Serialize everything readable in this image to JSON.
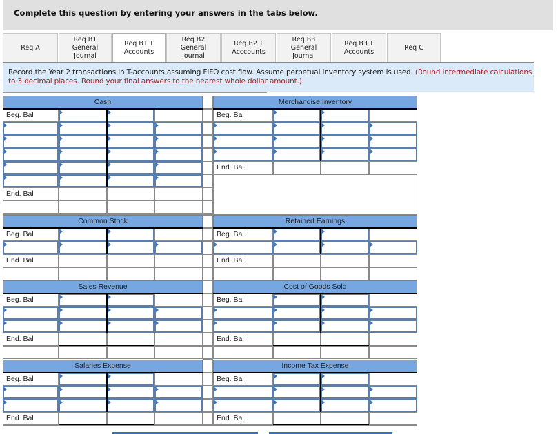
{
  "header": {
    "title": "Complete this question by entering your answers in the tabs below."
  },
  "tabs": [
    {
      "label": "Req A",
      "active": false
    },
    {
      "label": "Req B1\nGeneral\nJournal",
      "active": false
    },
    {
      "label": "Req B1 T\nAccounts",
      "active": true
    },
    {
      "label": "Req B2\nGeneral\nJournal",
      "active": false
    },
    {
      "label": "Req B2 T\nAcccounts",
      "active": false
    },
    {
      "label": "Req B3\nGeneral\nJournal",
      "active": false
    },
    {
      "label": "Req B3 T\nAccounts",
      "active": false
    },
    {
      "label": "Req C",
      "active": false
    }
  ],
  "instructions": {
    "text": "Record the Year 2 transactions in T-accounts assuming FIFO cost flow. Assume perpetual inventory system is used. ",
    "note": "(Round intermediate calculations to 3 decimal places. Round your final answers to the nearest whole dollar amount.)"
  },
  "labels": {
    "beg": "Beg. Bal",
    "end": "End. Bal"
  },
  "accounts": [
    {
      "name": "Cash",
      "side": "left",
      "entry_rows": 5,
      "extra_rows": 1
    },
    {
      "name": "Merchandise Inventory",
      "side": "right",
      "entry_rows": 3,
      "extra_rows": 3
    },
    {
      "name": "Common Stock",
      "side": "left",
      "entry_rows": 1,
      "extra_rows": 1
    },
    {
      "name": "Retained Earnings",
      "side": "right",
      "entry_rows": 1,
      "extra_rows": 1
    },
    {
      "name": "Sales Revenue",
      "side": "left",
      "entry_rows": 2,
      "extra_rows": 1
    },
    {
      "name": "Cost of Goods Sold",
      "side": "right",
      "entry_rows": 2,
      "extra_rows": 1
    },
    {
      "name": "Salaries Expense",
      "side": "left",
      "entry_rows": 2,
      "extra_rows": 0
    },
    {
      "name": "Income Tax Expense",
      "side": "right",
      "entry_rows": 2,
      "extra_rows": 0
    }
  ],
  "accent_colors": {
    "header_blue": "#76a7e0",
    "input_border": "#5c7ea9",
    "note_red": "#a5262a",
    "instr_bg": "#dbeaf8"
  }
}
